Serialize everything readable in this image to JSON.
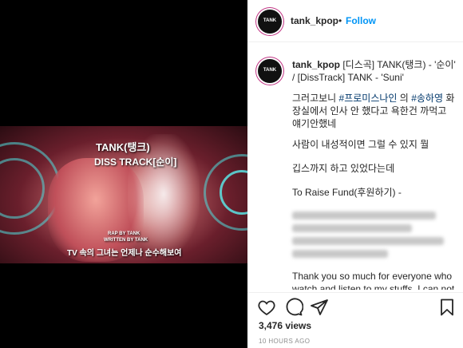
{
  "video": {
    "title_line1": "TANK(탱크)",
    "title_line2": "DISS TRACK[순이]",
    "credit1": "RAP BY TANK",
    "credit2": "WRITTEN BY TANK",
    "subtitle": "TV 속의 그녀는 언제나 순수해보여"
  },
  "header": {
    "avatar_label": "TANK",
    "username": "tank_kpop",
    "separator": "•",
    "follow_label": "Follow"
  },
  "post": {
    "avatar_label": "TANK",
    "username": "tank_kpop",
    "title_rest": " [디스곡] TANK(탱크) - '순이' / [DissTrack] TANK - 'Suni'",
    "line1a": "그러고보니 ",
    "tag1": "#프로미스나인",
    "line1b": " 의 ",
    "tag2": "#송하영",
    "line1c": " 화 장실에서 인사 안 했다고 욕한건 까먹고 얘기안했네",
    "line2": "사람이 내성적이면 그럴 수 있지 뭘",
    "line3": "깁스까지 하고 있었다는데",
    "line4": "To Raise Fund(후원하기) -",
    "line5": "Thank you so much for everyone who watch and listen to my stuffs. I can not"
  },
  "footer": {
    "views": "3,476 views",
    "time": "10 HOURS AGO"
  },
  "icons": [
    "heart-icon",
    "comment-icon",
    "share-icon",
    "bookmark-icon"
  ]
}
